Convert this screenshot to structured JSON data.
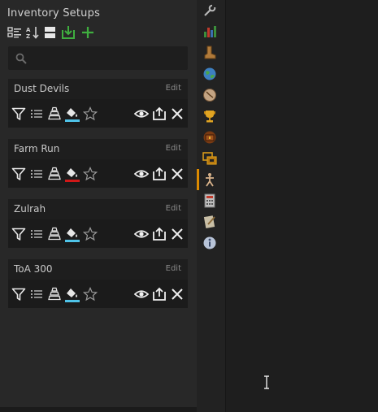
{
  "panel": {
    "title": "Inventory Setups"
  },
  "toolbar": {
    "buttons": [
      {
        "icon": "layout-list-icon"
      },
      {
        "icon": "sort-alpha-icon"
      },
      {
        "icon": "compact-view-icon"
      },
      {
        "icon": "import-icon"
      },
      {
        "icon": "add-icon"
      }
    ]
  },
  "search": {
    "placeholder": ""
  },
  "setups": [
    {
      "name": "Dust Devils",
      "edit_label": "Edit",
      "highlight_color": "#4fc3e8"
    },
    {
      "name": "Farm Run",
      "edit_label": "Edit",
      "highlight_color": "#d01818"
    },
    {
      "name": "Zulrah",
      "edit_label": "Edit",
      "highlight_color": "#4fc3e8"
    },
    {
      "name": "ToA 300",
      "edit_label": "Edit",
      "highlight_color": "#4fc3e8"
    }
  ],
  "sidebar": {
    "items": [
      {
        "icon": "wrench-icon"
      },
      {
        "icon": "stats-chart-icon"
      },
      {
        "icon": "boot-icon"
      },
      {
        "icon": "world-icon"
      },
      {
        "icon": "clock-icon"
      },
      {
        "icon": "trophy-icon"
      },
      {
        "icon": "chest-icon"
      },
      {
        "icon": "screenshot-icon"
      },
      {
        "icon": "inventory-setups-icon",
        "active": true
      },
      {
        "icon": "calculator-icon"
      },
      {
        "icon": "notes-icon"
      },
      {
        "icon": "info-icon"
      }
    ],
    "active_color": "#dc8a00"
  }
}
